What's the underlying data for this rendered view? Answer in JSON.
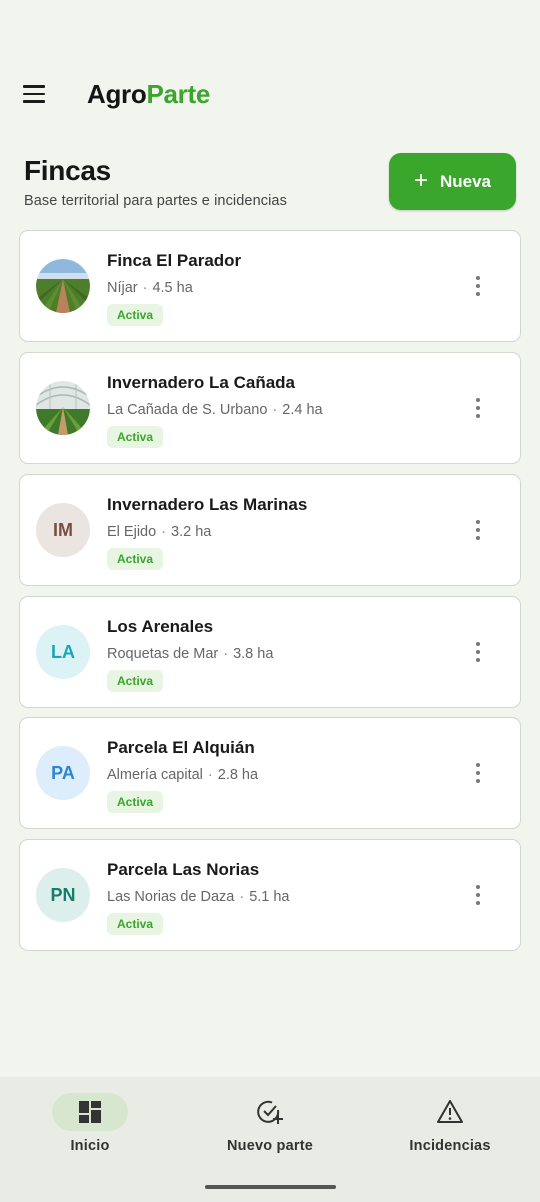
{
  "app": {
    "brand_part1": "Agro",
    "brand_part2": "Parte"
  },
  "page": {
    "title": "Fincas",
    "subtitle": "Base territorial para partes e incidencias"
  },
  "new_button": {
    "label": "Nueva",
    "icon": "plus-icon"
  },
  "farms": [
    {
      "name": "Finca El Parador",
      "location": "Níjar",
      "area": "4.5 ha",
      "status": "Activa",
      "avatar": "photo-field"
    },
    {
      "name": "Invernadero La Cañada",
      "location": "La Cañada de S. Urbano",
      "area": "2.4 ha",
      "status": "Activa",
      "avatar": "photo-greenhouse"
    },
    {
      "name": "Invernadero Las Marinas",
      "location": "El Ejido",
      "area": "3.2 ha",
      "status": "Activa",
      "avatar": "IM",
      "avatar_bg": "#ebe5e1",
      "avatar_fg": "#7a4f42"
    },
    {
      "name": "Los Arenales",
      "location": "Roquetas de Mar",
      "area": "3.8 ha",
      "status": "Activa",
      "avatar": "LA",
      "avatar_bg": "#dcf3f6",
      "avatar_fg": "#16a8b8"
    },
    {
      "name": "Parcela El Alquián",
      "location": "Almería capital",
      "area": "2.8 ha",
      "status": "Activa",
      "avatar": "PA",
      "avatar_bg": "#deedfb",
      "avatar_fg": "#2b86d1"
    },
    {
      "name": "Parcela Las Norias",
      "location": "Las Norias de Daza",
      "area": "5.1 ha",
      "status": "Activa",
      "avatar": "PN",
      "avatar_bg": "#dcefea",
      "avatar_fg": "#167d6b"
    }
  ],
  "bottom_nav": [
    {
      "label": "Inicio",
      "icon": "dashboard-icon",
      "active": true
    },
    {
      "label": "Nuevo parte",
      "icon": "check-add-icon",
      "active": false
    },
    {
      "label": "Incidencias",
      "icon": "warning-icon",
      "active": false
    }
  ],
  "colors": {
    "primary": "#3aa62c",
    "background": "#f2f4ee",
    "badge_bg": "#e8f5e3"
  }
}
